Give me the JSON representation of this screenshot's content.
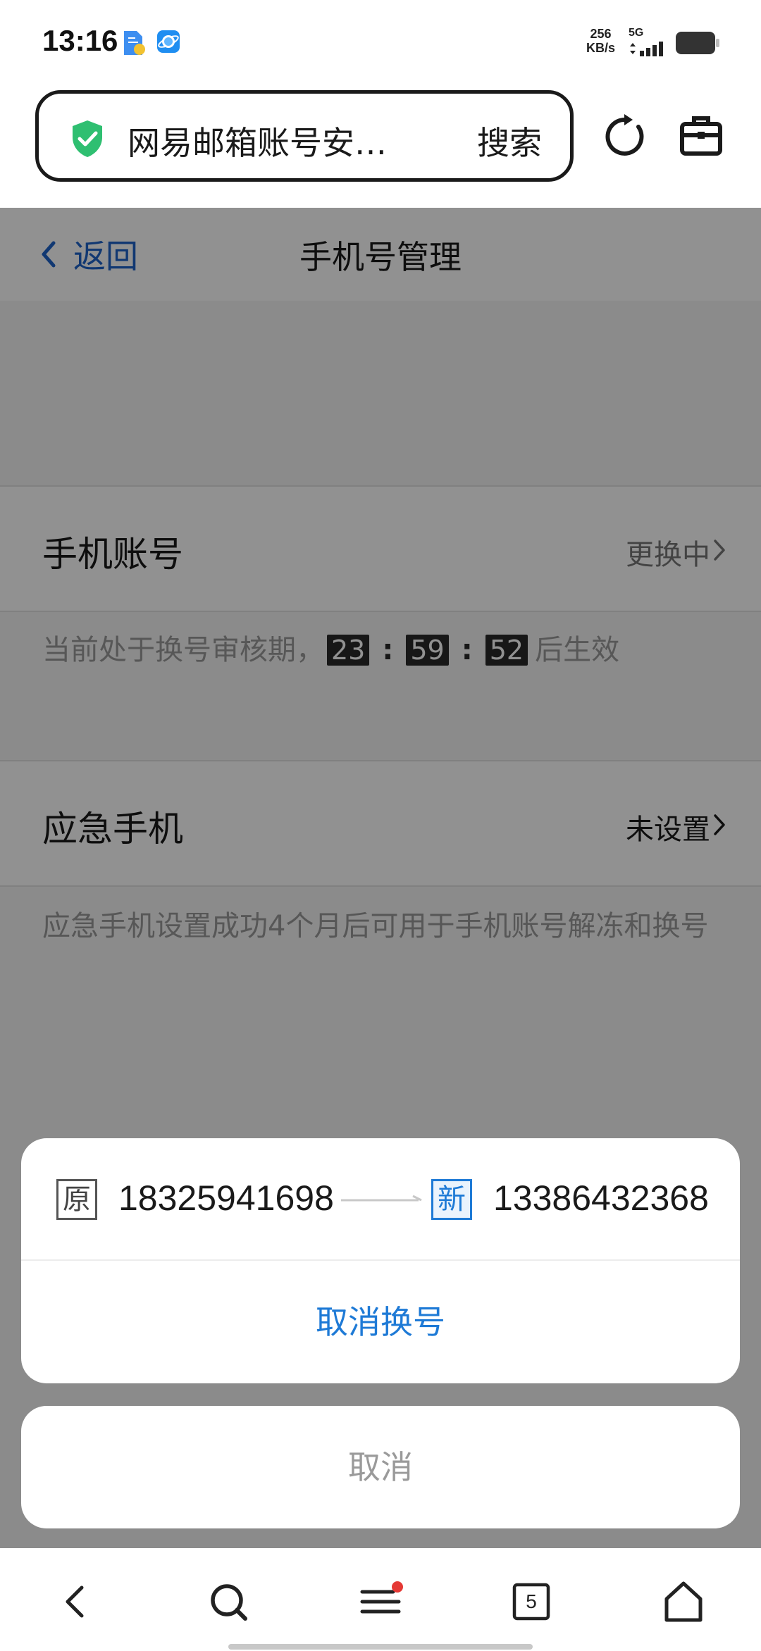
{
  "status_bar": {
    "time": "13:16",
    "net_speed_value": "256",
    "net_speed_unit": "KB/s",
    "network_type": "5G",
    "battery_color": "#333333"
  },
  "browser": {
    "url_text": "网易邮箱账号安…",
    "search_label": "搜索",
    "secure_color": "#2fbf71"
  },
  "header": {
    "back_label": "返回",
    "title": "手机号管理"
  },
  "phone_account": {
    "label": "手机账号",
    "status": "更换中",
    "note_prefix": "当前处于换号审核期，",
    "countdown": {
      "hours": "23",
      "minutes": "59",
      "seconds": "52"
    },
    "colon": ":",
    "note_suffix": "后生效"
  },
  "emergency_phone": {
    "label": "应急手机",
    "status": "未设置",
    "note": "应急手机设置成功4个月后可用于手机账号解冻和换号"
  },
  "action_sheet": {
    "old_tag": "原",
    "old_number": "18325941698",
    "new_tag": "新",
    "new_number": "13386432368",
    "cancel_change_label": "取消换号",
    "cancel_label": "取消",
    "accent_color": "#1e7ad6"
  },
  "bottom_bar": {
    "tabs_count": "5",
    "menu_badge_color": "#e53935"
  }
}
